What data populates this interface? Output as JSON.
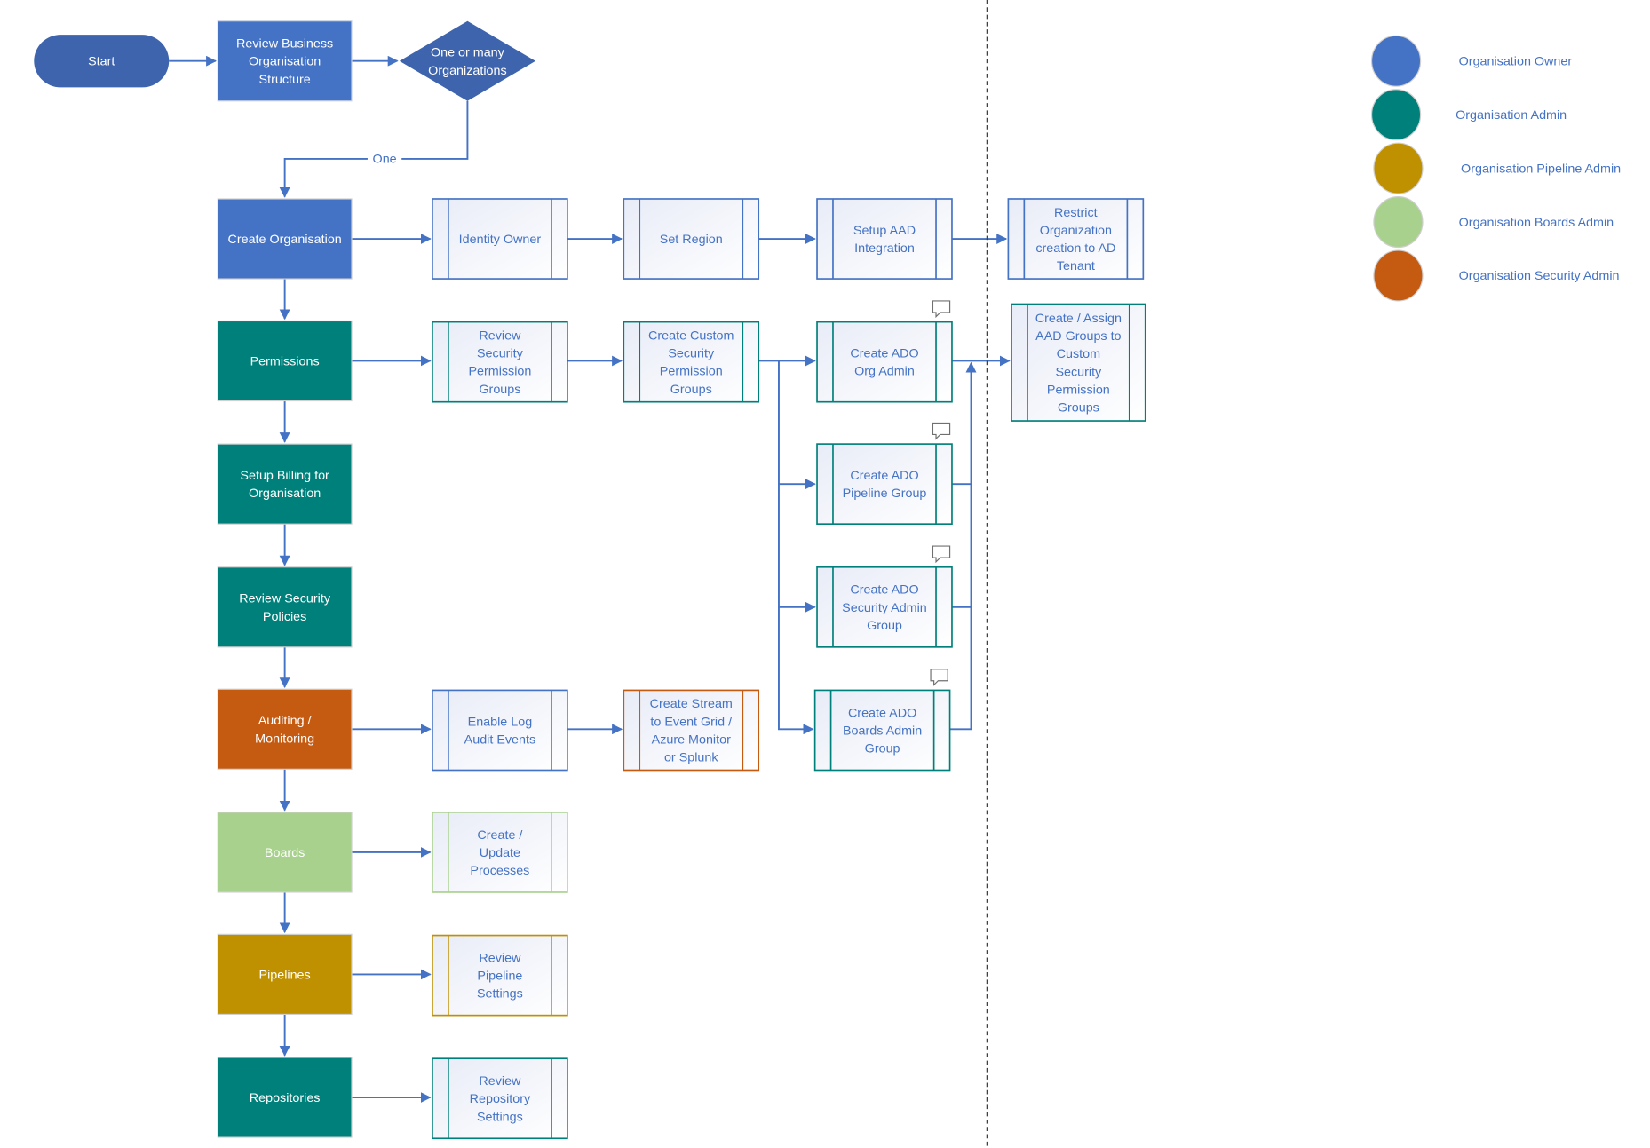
{
  "colors": {
    "owner": "#4472c4",
    "owner_dark": "#3e64ad",
    "admin": "#00807a",
    "pipeline": "#bf9000",
    "boards": "#a9d18e",
    "security": "#c55a11",
    "connector": "#4472c4",
    "sub_text": "#4472c4",
    "legend_text": "#4472c4"
  },
  "flow": {
    "start": "Start",
    "review_business": [
      "Review Business",
      "Organisation",
      "Structure"
    ],
    "decision": [
      "One or many",
      "Organizations"
    ],
    "decision_branch_label": "One"
  },
  "main_steps": [
    {
      "id": "create-organisation",
      "lines": [
        "Create Organisation"
      ],
      "role": "owner"
    },
    {
      "id": "permissions",
      "lines": [
        "Permissions"
      ],
      "role": "admin"
    },
    {
      "id": "setup-billing",
      "lines": [
        "Setup Billing for",
        "Organisation"
      ],
      "role": "admin"
    },
    {
      "id": "review-security-policies",
      "lines": [
        "Review Security",
        "Policies"
      ],
      "role": "admin"
    },
    {
      "id": "auditing-monitoring",
      "lines": [
        "Auditing /",
        "Monitoring"
      ],
      "role": "security"
    },
    {
      "id": "boards",
      "lines": [
        "Boards"
      ],
      "role": "boards"
    },
    {
      "id": "pipelines",
      "lines": [
        "Pipelines"
      ],
      "role": "pipeline"
    },
    {
      "id": "repositories",
      "lines": [
        "Repositories"
      ],
      "role": "admin"
    }
  ],
  "sub_steps": [
    {
      "id": "identity-owner",
      "lines": [
        "Identity Owner"
      ],
      "role": "owner",
      "comment": false
    },
    {
      "id": "set-region",
      "lines": [
        "Set Region"
      ],
      "role": "owner",
      "comment": false
    },
    {
      "id": "setup-aad-integration",
      "lines": [
        "Setup AAD",
        "Integration"
      ],
      "role": "owner",
      "comment": false
    },
    {
      "id": "restrict-org-creation",
      "lines": [
        "Restrict",
        "Organization",
        "creation to AD",
        "Tenant"
      ],
      "role": "owner",
      "comment": false
    },
    {
      "id": "review-security-permission-groups",
      "lines": [
        "Review",
        "Security",
        "Permission",
        "Groups"
      ],
      "role": "admin",
      "comment": false
    },
    {
      "id": "create-custom-security-permission-groups",
      "lines": [
        "Create Custom",
        "Security",
        "Permission",
        "Groups"
      ],
      "role": "admin",
      "comment": false
    },
    {
      "id": "create-ado-org-admin",
      "lines": [
        "Create ADO",
        "Org Admin"
      ],
      "role": "admin",
      "comment": true
    },
    {
      "id": "create-assign-aad-groups",
      "lines": [
        "Create / Assign",
        "AAD Groups to",
        "Custom",
        "Security",
        "Permission",
        "Groups"
      ],
      "role": "admin",
      "comment": false
    },
    {
      "id": "create-ado-pipeline-group",
      "lines": [
        "Create ADO",
        "Pipeline Group"
      ],
      "role": "admin",
      "comment": true
    },
    {
      "id": "create-ado-security-admin-group",
      "lines": [
        "Create ADO",
        "Security Admin",
        "Group"
      ],
      "role": "admin",
      "comment": true
    },
    {
      "id": "create-ado-boards-admin-group",
      "lines": [
        "Create ADO",
        "Boards Admin",
        "Group"
      ],
      "role": "admin",
      "comment": true
    },
    {
      "id": "enable-log-audit-events",
      "lines": [
        "Enable Log",
        "Audit Events"
      ],
      "role": "owner",
      "comment": false
    },
    {
      "id": "create-stream",
      "lines": [
        "Create Stream",
        "to Event Grid /",
        "Azure Monitor",
        "or Splunk"
      ],
      "role": "security",
      "comment": false
    },
    {
      "id": "create-update-processes",
      "lines": [
        "Create /",
        "Update",
        "Processes"
      ],
      "role": "boards",
      "comment": false
    },
    {
      "id": "review-pipeline-settings",
      "lines": [
        "Review",
        "Pipeline",
        "Settings"
      ],
      "role": "pipeline",
      "comment": false
    },
    {
      "id": "review-repository-settings",
      "lines": [
        "Review",
        "Repository",
        "Settings"
      ],
      "role": "admin",
      "comment": false
    }
  ],
  "legend": [
    {
      "role": "owner",
      "label": "Organisation Owner"
    },
    {
      "role": "admin",
      "label": "Organisation Admin"
    },
    {
      "role": "pipeline",
      "label": "Organisation Pipeline Admin"
    },
    {
      "role": "boards",
      "label": "Organisation Boards Admin"
    },
    {
      "role": "security",
      "label": "Organisation Security Admin"
    }
  ]
}
